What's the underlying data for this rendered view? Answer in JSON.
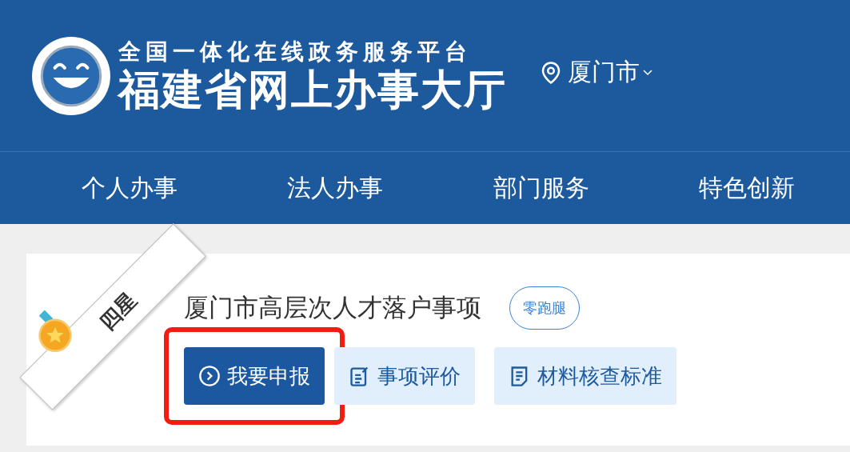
{
  "header": {
    "subtitle": "全国一体化在线政务服务平台",
    "title": "福建省网上办事大厅",
    "location": "厦门市"
  },
  "nav": [
    {
      "label": "个人办事",
      "selected": false
    },
    {
      "label": "法人办事",
      "selected": false
    },
    {
      "label": "部门服务",
      "selected": false
    },
    {
      "label": "特色创新",
      "selected": false
    }
  ],
  "item": {
    "rating": "四星",
    "title": "厦门市高层次人才落户事项",
    "tag": "零跑腿",
    "actions": [
      {
        "label": "我要申报",
        "kind": "primary",
        "highlighted": true
      },
      {
        "label": "事项评价",
        "kind": "evaluate",
        "highlighted": false
      },
      {
        "label": "材料核查标准",
        "kind": "document",
        "highlighted": false
      }
    ]
  }
}
